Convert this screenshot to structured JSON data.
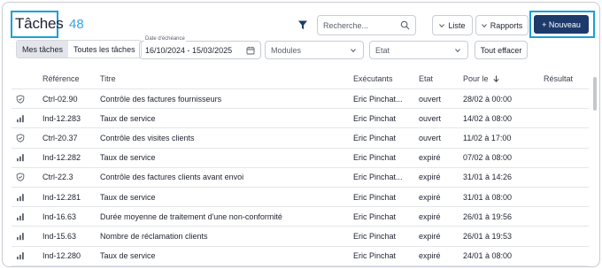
{
  "header": {
    "title": "Tâches",
    "count": "48",
    "search_placeholder": "Recherche...",
    "liste_label": "Liste",
    "rapports_label": "Rapports",
    "new_label": "+ Nouveau"
  },
  "filters": {
    "tabs": [
      {
        "label": "Mes tâches",
        "active": true
      },
      {
        "label": "Toutes les tâches",
        "active": false
      }
    ],
    "date_label": "Date d'échéance",
    "date_value": "16/10/2024 - 15/03/2025",
    "modules_placeholder": "Modules",
    "etat_placeholder": "Etat",
    "clear_label": "Tout effacer"
  },
  "table": {
    "columns": {
      "ref": "Référence",
      "title": "Titre",
      "exec": "Exécutants",
      "etat": "Etat",
      "date": "Pour le",
      "result": "Résultat"
    },
    "rows": [
      {
        "icon": "shield-check-icon",
        "ref": "Ctrl-02.90",
        "title": "Contrôle des factures fournisseurs",
        "exec": "Eric Pinchat...",
        "etat": "ouvert",
        "date": "28/02 à 00:00",
        "result": ""
      },
      {
        "icon": "bar-chart-icon",
        "ref": "Ind-12.283",
        "title": "Taux de service",
        "exec": "Eric Pinchat",
        "etat": "ouvert",
        "date": "14/02 à 08:00",
        "result": ""
      },
      {
        "icon": "shield-check-icon",
        "ref": "Ctrl-20.37",
        "title": "Contrôle des visites clients",
        "exec": "Eric Pinchat",
        "etat": "ouvert",
        "date": "11/02 à 17:00",
        "result": ""
      },
      {
        "icon": "bar-chart-icon",
        "ref": "Ind-12.282",
        "title": "Taux de service",
        "exec": "Eric Pinchat",
        "etat": "expiré",
        "date": "07/02 à 08:00",
        "result": ""
      },
      {
        "icon": "shield-check-icon",
        "ref": "Ctrl-22.3",
        "title": "Contrôle des factures clients avant envoi",
        "exec": "Eric Pinchat...",
        "etat": "expiré",
        "date": "31/01 à 14:26",
        "result": ""
      },
      {
        "icon": "bar-chart-icon",
        "ref": "Ind-12.281",
        "title": "Taux de service",
        "exec": "Eric Pinchat",
        "etat": "expiré",
        "date": "31/01 à 08:00",
        "result": ""
      },
      {
        "icon": "bar-chart-icon",
        "ref": "Ind-16.63",
        "title": "Durée moyenne de traitement d'une non-conformité",
        "exec": "Eric Pinchat",
        "etat": "expiré",
        "date": "26/01 à 19:56",
        "result": ""
      },
      {
        "icon": "bar-chart-icon",
        "ref": "Ind-15.63",
        "title": "Nombre de réclamation clients",
        "exec": "Eric Pinchat",
        "etat": "expiré",
        "date": "26/01 à 19:53",
        "result": ""
      },
      {
        "icon": "bar-chart-icon",
        "ref": "Ind-12.280",
        "title": "Taux de service",
        "exec": "Eric Pinchat",
        "etat": "expiré",
        "date": "24/01 à 08:00",
        "result": ""
      }
    ]
  },
  "colors": {
    "accent": "#1aa0d8",
    "primary": "#1e3a6b",
    "count": "#3aa2e0"
  }
}
